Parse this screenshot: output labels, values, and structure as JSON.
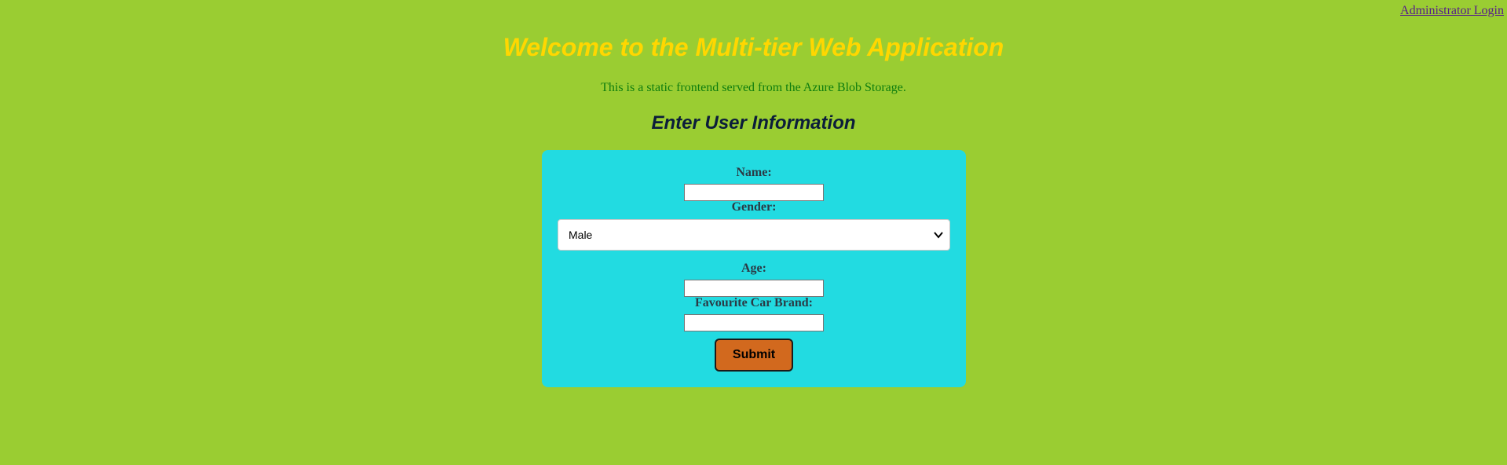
{
  "header": {
    "admin_link": "Administrator Login"
  },
  "main": {
    "title": "Welcome to the Multi-tier Web Application",
    "subtitle": "This is a static frontend served from the Azure Blob Storage.",
    "form_heading": "Enter User Information"
  },
  "form": {
    "name_label": "Name:",
    "name_value": "",
    "gender_label": "Gender:",
    "gender_selected": "Male",
    "age_label": "Age:",
    "age_value": "",
    "car_label": "Favourite Car Brand:",
    "car_value": "",
    "submit_label": "Submit"
  },
  "colors": {
    "background": "#9acd32",
    "title": "#ffd700",
    "subtitle": "#0e7d0e",
    "heading": "#0b1d3a",
    "form_card": "#22dbe1",
    "submit_button": "#d2691e",
    "link": "#551a8b"
  },
  "icons": {
    "select_arrow": "chevron-down-icon"
  }
}
